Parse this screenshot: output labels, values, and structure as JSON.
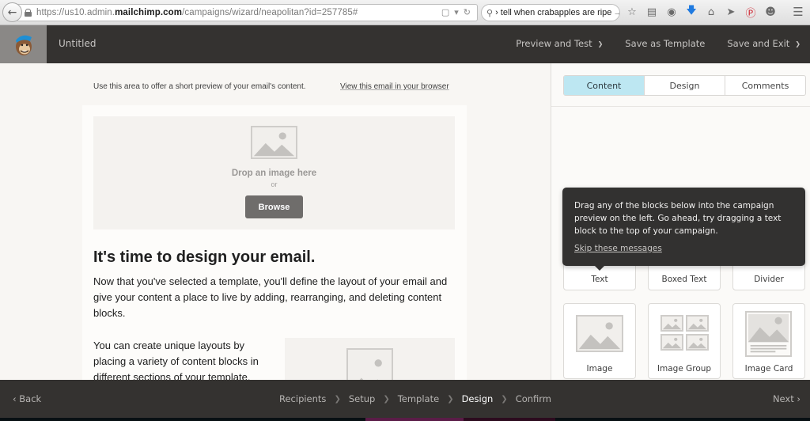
{
  "browser": {
    "url_prefix": "https://us10.admin.",
    "url_domain": "mailchimp.com",
    "url_path": "/campaigns/wizard/neapolitan?id=257785#",
    "search_value": "› tell when crabapples are ripe",
    "toolbar_icons": [
      "bookmark-star-icon",
      "reading-list-icon",
      "pocket-icon",
      "download-icon",
      "home-icon",
      "send-icon",
      "pinterest-icon",
      "chat-icon",
      "menu-icon"
    ]
  },
  "header": {
    "campaign_title": "Untitled",
    "nav": [
      {
        "label": "Preview and Test",
        "has_dropdown": true
      },
      {
        "label": "Save as Template",
        "has_dropdown": false
      },
      {
        "label": "Save and Exit",
        "has_dropdown": true
      }
    ]
  },
  "email": {
    "preheader": "Use this area to offer a short preview of your email's content.",
    "view_in_browser": "View this email in your browser",
    "image_drop": {
      "drop_text": "Drop an image here",
      "or_text": "or",
      "browse_label": "Browse"
    },
    "headline": "It's time to design your email.",
    "paragraph1": "Now that you've selected a template, you'll define the layout of your email and give your content a place to live by adding, rearranging, and deleting content blocks.",
    "paragraph2": "You can create unique layouts by placing a variety of content blocks in different sections of your template."
  },
  "panel": {
    "tabs": [
      {
        "label": "Content",
        "active": true
      },
      {
        "label": "Design",
        "active": false
      },
      {
        "label": "Comments",
        "active": false
      }
    ],
    "blocks": [
      {
        "label": "Text"
      },
      {
        "label": "Boxed Text"
      },
      {
        "label": "Divider"
      },
      {
        "label": "Image"
      },
      {
        "label": "Image Group"
      },
      {
        "label": "Image Card"
      }
    ],
    "tooltip": {
      "text": "Drag any of the blocks below into the campaign preview on the left. Go ahead, try dragging a text block to the top of your campaign.",
      "skip_label": "Skip these messages"
    },
    "active_tab_color": "#bde7f2"
  },
  "footer": {
    "back_label": "Back",
    "steps": [
      {
        "label": "Recipients",
        "active": false
      },
      {
        "label": "Setup",
        "active": false
      },
      {
        "label": "Template",
        "active": false
      },
      {
        "label": "Design",
        "active": true
      },
      {
        "label": "Confirm",
        "active": false
      }
    ],
    "next_label": "Next"
  }
}
